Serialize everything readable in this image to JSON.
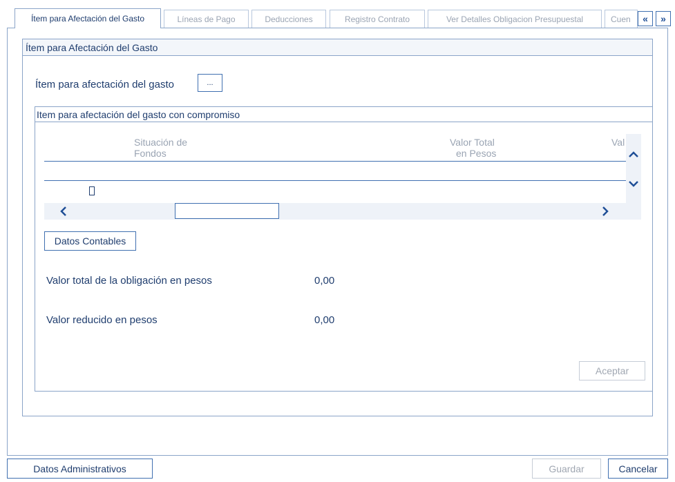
{
  "tabs": [
    {
      "label": "Ítem para Afectación del Gasto",
      "active": true
    },
    {
      "label": "Líneas de Pago",
      "active": false
    },
    {
      "label": "Deducciones",
      "active": false
    },
    {
      "label": "Registro Contrato",
      "active": false
    },
    {
      "label": "Ver Detalles Obligacion Presupuestal",
      "active": false
    },
    {
      "label": "Cuen",
      "active": false
    }
  ],
  "tab_nav": {
    "prev": "«",
    "next": "»"
  },
  "panel": {
    "title": "Ítem para Afectación del Gasto",
    "item_label": "Ítem para afectación del gasto",
    "item_button": "...",
    "sub_panel_title": "Item para afectación del gasto con compromiso",
    "grid": {
      "col1": {
        "line1": "Situación de",
        "line2": "Fondos"
      },
      "col2": {
        "line1": "Valor Total",
        "line2": "en Pesos"
      },
      "col3": "Val"
    },
    "datos_contables": "Datos Contables",
    "valor_total_label": "Valor total de la obligación en pesos",
    "valor_total_value": "0,00",
    "valor_reducido_label": "Valor reducido en pesos",
    "valor_reducido_value": "0,00",
    "aceptar": "Aceptar"
  },
  "footer": {
    "datos_administrativos": "Datos Administrativos",
    "guardar": "Guardar",
    "cancelar": "Cancelar"
  },
  "colors": {
    "accent": "#3f6fb0",
    "text": "#1f3d6e",
    "disabled": "#a0a7b2"
  }
}
